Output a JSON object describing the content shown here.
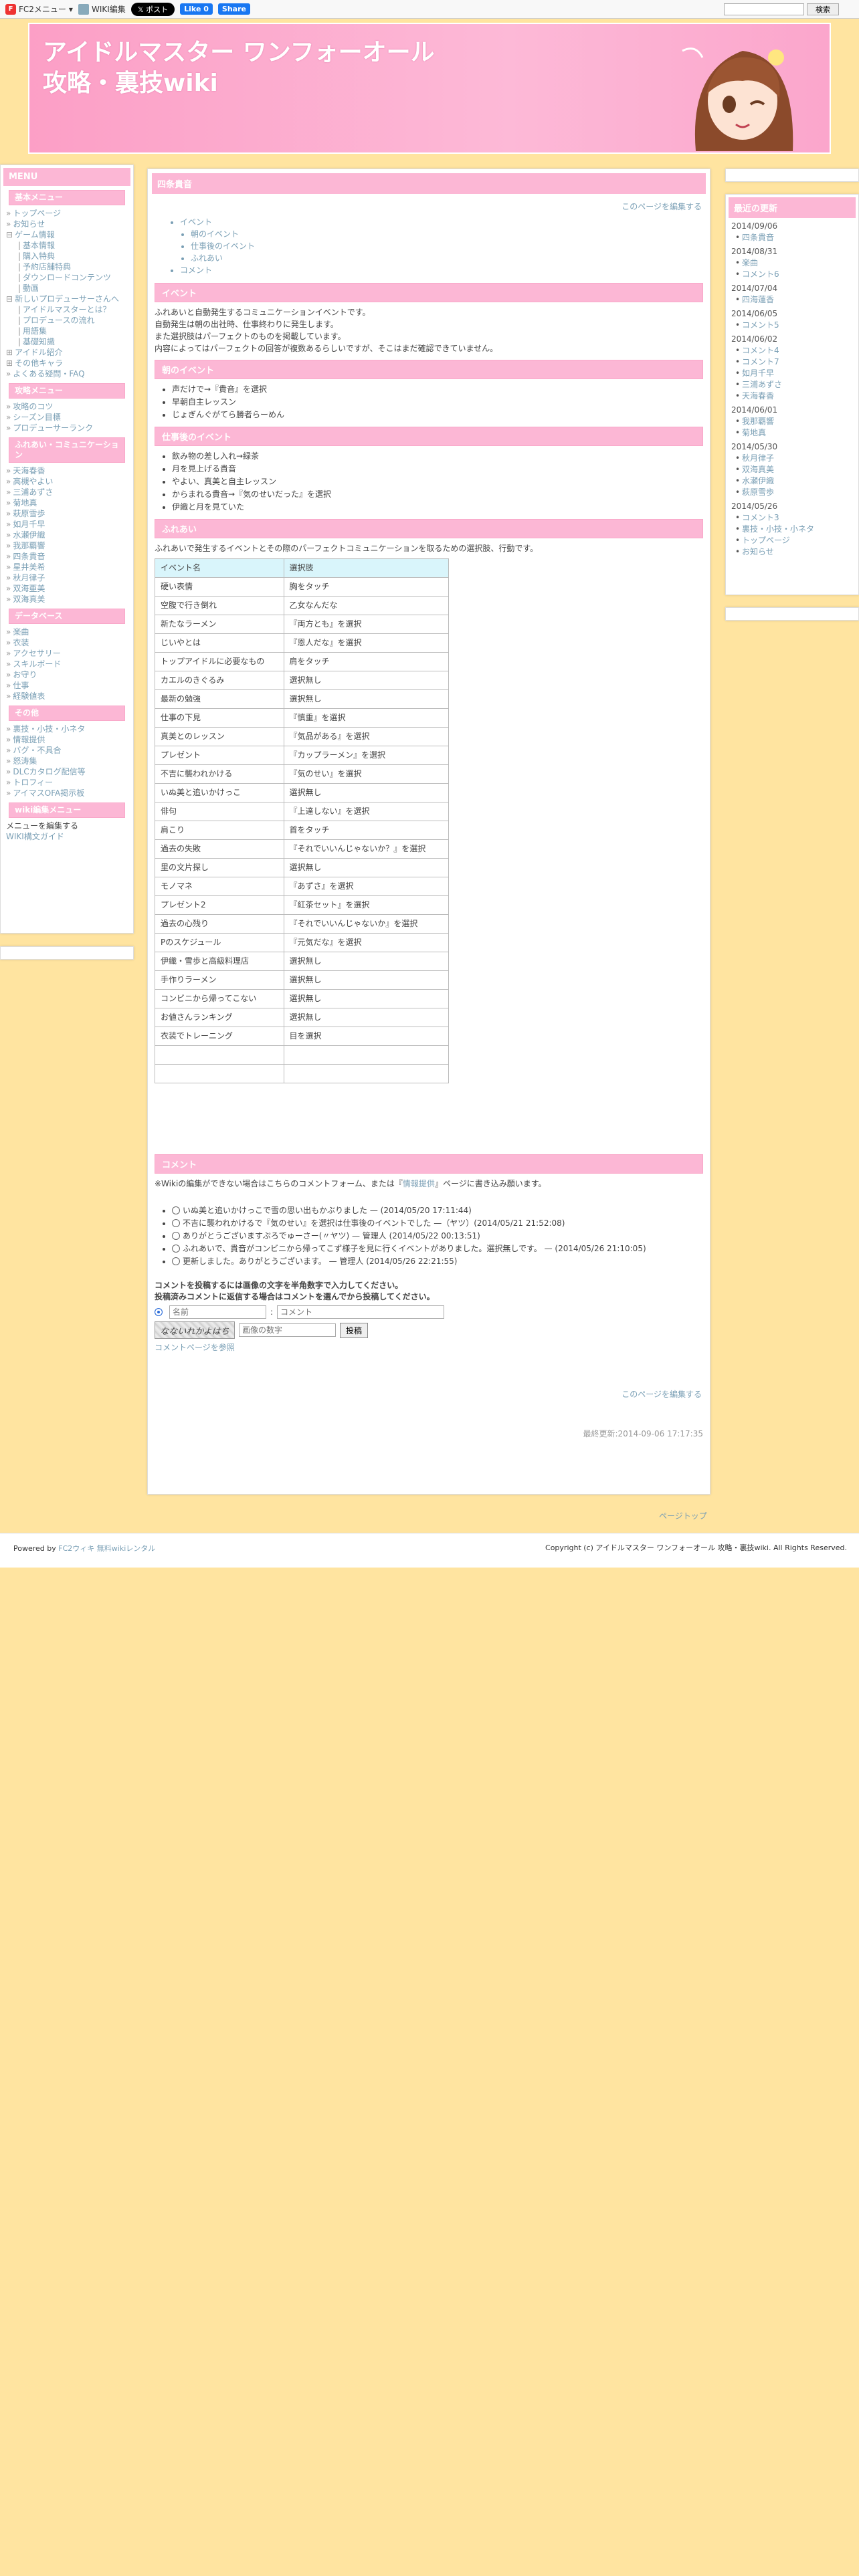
{
  "topbar": {
    "fc2_menu": "FC2メニュー",
    "wiki_edit": "WIKI編集",
    "x_post": "ポスト",
    "fb_like": "Like 0",
    "fb_share": "Share",
    "search_button": "検索"
  },
  "header": {
    "title_line1": "アイドルマスター ワンフォーオール",
    "title_line2": "攻略・裏技wiki"
  },
  "leftnav": {
    "title": "MENU",
    "basic_heading": "基本メニュー",
    "basic_items": [
      "トップページ",
      "お知らせ"
    ],
    "game_info": "ゲーム情報",
    "game_sub": [
      "基本情報",
      "購入特典",
      "予約店舗特典",
      "ダウンロードコンテンツ",
      "動画"
    ],
    "new_producer": "新しいプロデューサーさんへ",
    "new_producer_sub": [
      "アイドルマスターとは？",
      "プロデュースの流れ",
      "用語集",
      "基礎知識"
    ],
    "idol_intro": "アイドル紹介",
    "other_chars": "その他キャラ",
    "faq": "よくある疑問・FAQ",
    "strategy_heading": "攻略メニュー",
    "strategy_items": [
      "攻略のコツ",
      "シーズン目標",
      "プロデューサーランク"
    ],
    "fureai_heading": "ふれあい・コミュニケーション",
    "fureai_items": [
      "天海春香",
      "高槻やよい",
      "三浦あずさ",
      "菊地真",
      "萩原雪歩",
      "如月千早",
      "水瀬伊織",
      "我那覇響",
      "四条貴音",
      "星井美希",
      "秋月律子",
      "双海亜美",
      "双海真美"
    ],
    "database_heading": "データベース",
    "database_items": [
      "楽曲",
      "衣装",
      "アクセサリー",
      "スキルボード",
      "お守り",
      "仕事",
      "経験値表"
    ],
    "other_heading": "その他",
    "other_items": [
      "裏技・小技・小ネタ",
      "情報提供",
      "バグ・不具合",
      "怒涛集",
      "DLCカタログ配信等",
      "トロフィー",
      "アイマスOFA掲示板"
    ],
    "wiki_edit_heading": "wiki編集メニュー",
    "wiki_edit_text": "メニューを編集する",
    "wiki_guide": "WIKI構文ガイド"
  },
  "main": {
    "page_title": "四条貴音",
    "edit_link": "このページを編集する",
    "toc": [
      "イベント",
      "朝のイベント",
      "仕事後のイベント",
      "ふれあい",
      "コメント"
    ],
    "event_heading": "イベント",
    "event_text": [
      "ふれあいと自動発生するコミュニケーションイベントです。",
      "自動発生は朝の出社時、仕事終わりに発生します。",
      "また選択肢はパーフェクトのものを掲載しています。",
      "内容によってはパーフェクトの回答が複数あるらしいですが、そこはまだ確認できていません。"
    ],
    "morning_heading": "朝のイベント",
    "morning_items": [
      "声だけで→『貴音』を選択",
      "早朝自主レッスン",
      "じょぎんぐがてら勝者らーめん"
    ],
    "afterwork_heading": "仕事後のイベント",
    "afterwork_items": [
      "飲み物の差し入れ→緑茶",
      "月を見上げる貴音",
      "やよい、真美と自主レッスン",
      "からまれる貴音→『気のせいだった』を選択",
      "伊織と月を見ていた"
    ],
    "fureai_heading": "ふれあい",
    "fureai_text": "ふれあいで発生するイベントとその際のパーフェクトコミュニケーションを取るための選択肢、行動です。",
    "table_header": [
      "イベント名",
      "選択肢"
    ],
    "table_rows": [
      [
        "硬い表情",
        "胸をタッチ"
      ],
      [
        "空腹で行き倒れ",
        "乙女なんだな"
      ],
      [
        "新たなラーメン",
        "『両方とも』を選択"
      ],
      [
        "じいやとは",
        "『恩人だな』を選択"
      ],
      [
        "トップアイドルに必要なもの",
        "肩をタッチ"
      ],
      [
        "カエルのきぐるみ",
        "選択無し"
      ],
      [
        "最新の勉強",
        "選択無し"
      ],
      [
        "仕事の下見",
        "『慎重』を選択"
      ],
      [
        "真美とのレッスン",
        "『気品がある』を選択"
      ],
      [
        "プレゼント",
        "『カップラーメン』を選択"
      ],
      [
        "不吉に襲われかける",
        "『気のせい』を選択"
      ],
      [
        "いぬ美と追いかけっこ",
        "選択無し"
      ],
      [
        "俳句",
        "『上達しない』を選択"
      ],
      [
        "肩こり",
        "首をタッチ"
      ],
      [
        "過去の失敗",
        "『それでいいんじゃないか？』を選択"
      ],
      [
        "里の文片探し",
        "選択無し"
      ],
      [
        "モノマネ",
        "『あずさ』を選択"
      ],
      [
        "プレゼント2",
        "『紅茶セット』を選択"
      ],
      [
        "過去の心残り",
        "『それでいいんじゃないか』を選択"
      ],
      [
        "Pのスケジュール",
        "『元気だな』を選択"
      ],
      [
        "伊織・雪歩と高級料理店",
        "選択無し"
      ],
      [
        "手作りラーメン",
        "選択無し"
      ],
      [
        "コンビニから帰ってこない",
        "選択無し"
      ],
      [
        "お値さんランキング",
        "選択無し"
      ],
      [
        "衣装でトレーニング",
        "目を選択"
      ],
      [
        "",
        ""
      ],
      [
        "",
        ""
      ]
    ],
    "comment_heading": "コメント",
    "comment_intro_pre": "※Wikiの編集ができない場合はこちらのコメントフォーム、または『",
    "comment_intro_link": "情報提供",
    "comment_intro_post": "』ページに書き込み願います。",
    "comments": [
      "いぬ美と追いかけっこで雪の思い出もかぶりました — (2014/05/20 17:11:44)",
      "不吉に襲われかけるで『気のせい』を選択は仕事後のイベントでした —（ヤツ）(2014/05/21 21:52:08)",
      "ありがとうございますぷろでゅーさー(〃ヤツ) — 管理人 (2014/05/22 00:13:51)",
      "ふれあいで、貴音がコンビニから帰ってこず様子を見に行くイベントがありました。選択無しです。 — (2014/05/26 21:10:05)",
      "更新しました。ありがとうございます。 — 管理人 (2014/05/26 22:21:55)"
    ],
    "comment_note1": "コメントを投稿するには画像の文字を半角数字で入力してください。",
    "comment_note2": "投稿済みコメントに返信する場合はコメントを選んでから投稿してください。",
    "name_placeholder": "名前",
    "comment_placeholder": "コメント",
    "captcha_text": "なないれかよはち",
    "captcha_placeholder": "画像の数字",
    "post_button": "投稿",
    "comment_page_link": "コメントページを参照",
    "edit_link_bottom": "このページを編集する",
    "last_modified": "最終更新:2014-09-06 17:17:35"
  },
  "rightnav": {
    "title": "最近の更新",
    "groups": [
      {
        "date": "2014/09/06",
        "items": [
          "四条貴音"
        ]
      },
      {
        "date": "2014/08/31",
        "items": [
          "楽曲",
          "コメント6"
        ]
      },
      {
        "date": "2014/07/04",
        "items": [
          "四海蓮香"
        ]
      },
      {
        "date": "2014/06/05",
        "items": [
          "コメント5"
        ]
      },
      {
        "date": "2014/06/02",
        "items": [
          "コメント4",
          "コメント7",
          "如月千早",
          "三浦あずさ",
          "天海春香"
        ]
      },
      {
        "date": "2014/06/01",
        "items": [
          "我那覇響",
          "菊地真"
        ]
      },
      {
        "date": "2014/05/30",
        "items": [
          "秋月律子",
          "双海真美",
          "水瀬伊織",
          "萩原雪歩"
        ]
      },
      {
        "date": "2014/05/26",
        "items": [
          "コメント3",
          "裏技・小技・小ネタ",
          "トップページ",
          "お知らせ"
        ]
      }
    ]
  },
  "pagetop": "ページトップ",
  "footer": {
    "powered_pre": "Powered by ",
    "fc2wiki": "FC2ウィキ",
    "free_rental": "無料wikiレンタル",
    "copyright": "Copyright (c) アイドルマスター ワンフォーオール 攻略・裏技wiki. All Rights Reserved."
  }
}
